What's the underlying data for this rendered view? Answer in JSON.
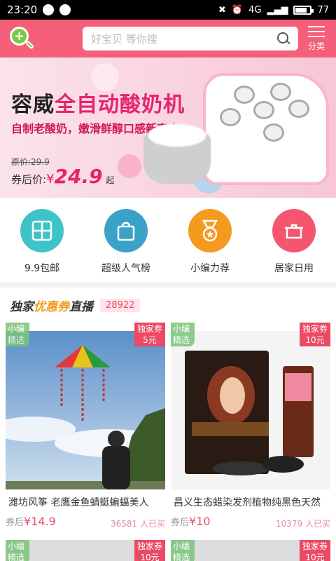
{
  "status": {
    "time": "23:20",
    "network": "4G",
    "battery": "77"
  },
  "header": {
    "search_placeholder": "好宝贝 等你搜",
    "category_label": "分类"
  },
  "banner": {
    "title_a": "容威",
    "title_b": "全自动酸奶机",
    "subtitle": "自制老酸奶，嫩滑鲜醇口感新高度",
    "original_price": "原价:29.9",
    "after_label": "券后价:",
    "yen": "¥",
    "price": "24.9",
    "suffix": "起"
  },
  "categories": [
    {
      "label": "9.9包邮",
      "color": "#3fc3c8"
    },
    {
      "label": "超级人气榜",
      "color": "#3aa2c6"
    },
    {
      "label": "小编力荐",
      "color": "#f39a1f"
    },
    {
      "label": "居家日用",
      "color": "#f5566f"
    }
  ],
  "section": {
    "part1": "独家",
    "part2": "优惠券",
    "part3": "直播",
    "count": "28922"
  },
  "products": [
    {
      "tag_left": "小编精选",
      "tag_right_1": "独家券",
      "tag_right_2": "5元",
      "name": "潍坊风筝 老鹰金鱼蜻蜓蝙蝠美人",
      "price_label": "券后",
      "price": "¥14.9",
      "sold_num": "36581",
      "sold_suffix": " 人已买"
    },
    {
      "tag_left": "小编精选",
      "tag_right_1": "独家券",
      "tag_right_2": "10元",
      "name": "昌义生态蜡染发剂植物纯黑色天然",
      "price_label": "券后",
      "price": "¥10",
      "sold_num": "10379",
      "sold_suffix": " 人已买"
    }
  ],
  "products_next": [
    {
      "tag_left": "小编精选",
      "tag_right_1": "独家券",
      "tag_right_2": "10元"
    },
    {
      "tag_left": "小编精选",
      "tag_right_1": "独家券",
      "tag_right_2": "10元"
    }
  ]
}
